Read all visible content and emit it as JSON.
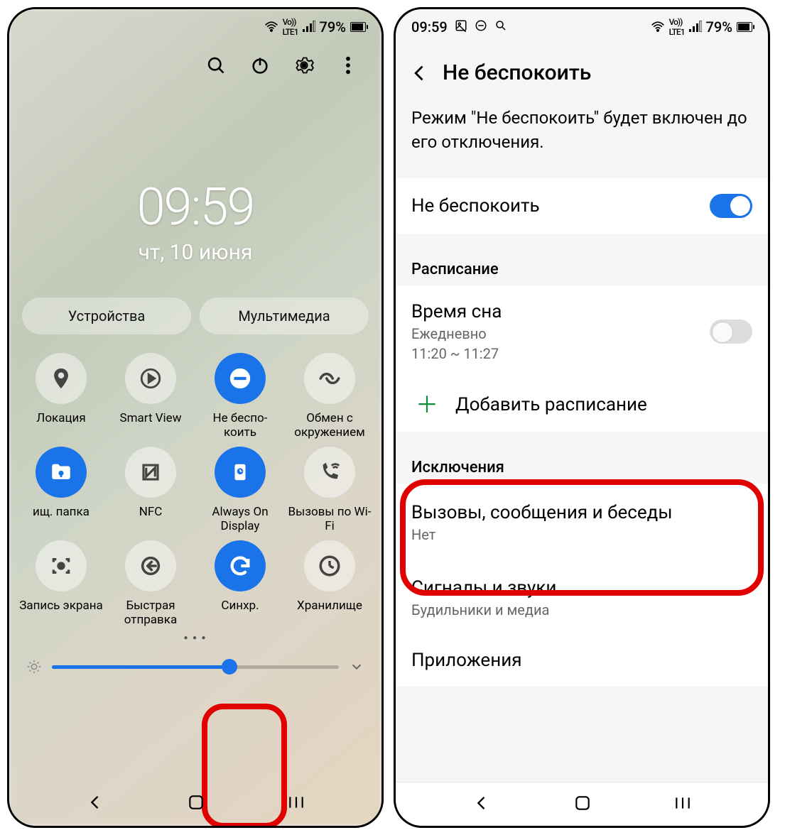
{
  "left": {
    "status": {
      "battery": "79%"
    },
    "time": "09:59",
    "date": "чт, 10 июня",
    "chips": {
      "devices": "Устройства",
      "media": "Мультимедиа"
    },
    "qs": [
      {
        "label": "Локация",
        "active": false,
        "icon": "pin"
      },
      {
        "label": "Smart View",
        "active": false,
        "icon": "cast"
      },
      {
        "label": "Не беспо-\nкоить",
        "active": true,
        "icon": "dnd"
      },
      {
        "label": "Обмен с окружением",
        "active": false,
        "icon": "share"
      },
      {
        "label": "ищ. папка",
        "active": true,
        "icon": "folder"
      },
      {
        "label": "NFC",
        "active": false,
        "icon": "nfc"
      },
      {
        "label": "Always On Display",
        "active": true,
        "icon": "aod"
      },
      {
        "label": "Вызовы по Wi-Fi",
        "active": false,
        "icon": "wificall"
      },
      {
        "label": "Запись экрана",
        "active": false,
        "icon": "rec"
      },
      {
        "label": "Быстрая отправка",
        "active": false,
        "icon": "quick"
      },
      {
        "label": "Синхр.",
        "active": true,
        "icon": "sync"
      },
      {
        "label": "Хранилище",
        "active": false,
        "icon": "clock"
      }
    ]
  },
  "right": {
    "status": {
      "time": "09:59",
      "battery": "79%"
    },
    "title": "Не беспокоить",
    "desc": "Режим \"Не беспокоить\" будет включен до его отключения.",
    "dnd_row": "Не беспокоить",
    "schedule_label": "Расписание",
    "sleep": {
      "title": "Время сна",
      "sub1": "Ежедневно",
      "sub2": "11:20 ~ 11:27"
    },
    "add_schedule": "Добавить расписание",
    "exceptions_label": "Исключения",
    "calls": {
      "title": "Вызовы, сообщения и беседы",
      "sub": "Нет"
    },
    "alarms": {
      "title": "Сигналы и звуки",
      "sub": "Будильники и медиа"
    },
    "apps": {
      "title": "Приложения"
    }
  }
}
